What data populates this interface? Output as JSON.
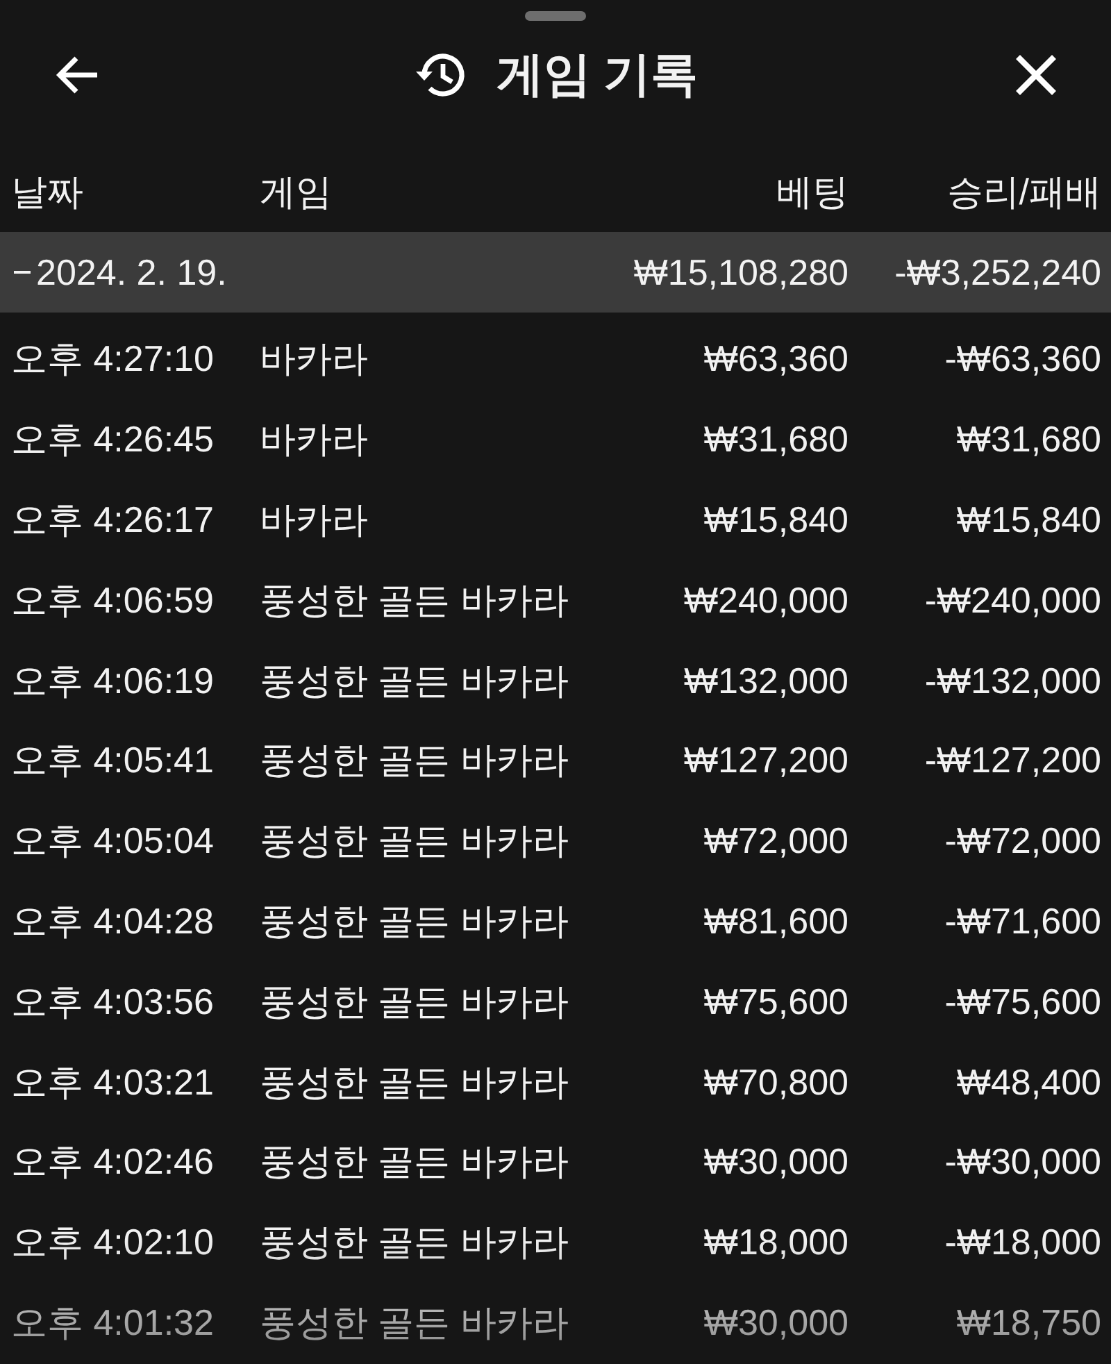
{
  "sheet": {
    "title": "게임 기록"
  },
  "columns": [
    "날짜",
    "게임",
    "베팅",
    "승리/패배"
  ],
  "groups": [
    {
      "date": "2024. 2. 19.",
      "expanded": true,
      "total_bet": "₩15,108,280",
      "total_result": "-₩3,252,240",
      "rows": [
        {
          "time": "오후 4:27:10",
          "game": "바카라",
          "bet": "₩63,360",
          "result": "-₩63,360"
        },
        {
          "time": "오후 4:26:45",
          "game": "바카라",
          "bet": "₩31,680",
          "result": "₩31,680"
        },
        {
          "time": "오후 4:26:17",
          "game": "바카라",
          "bet": "₩15,840",
          "result": "₩15,840"
        },
        {
          "time": "오후 4:06:59",
          "game": "풍성한 골든 바카라",
          "bet": "₩240,000",
          "result": "-₩240,000"
        },
        {
          "time": "오후 4:06:19",
          "game": "풍성한 골든 바카라",
          "bet": "₩132,000",
          "result": "-₩132,000"
        },
        {
          "time": "오후 4:05:41",
          "game": "풍성한 골든 바카라",
          "bet": "₩127,200",
          "result": "-₩127,200"
        },
        {
          "time": "오후 4:05:04",
          "game": "풍성한 골든 바카라",
          "bet": "₩72,000",
          "result": "-₩72,000"
        },
        {
          "time": "오후 4:04:28",
          "game": "풍성한 골든 바카라",
          "bet": "₩81,600",
          "result": "-₩71,600"
        },
        {
          "time": "오후 4:03:56",
          "game": "풍성한 골든 바카라",
          "bet": "₩75,600",
          "result": "-₩75,600"
        },
        {
          "time": "오후 4:03:21",
          "game": "풍성한 골든 바카라",
          "bet": "₩70,800",
          "result": "₩48,400"
        },
        {
          "time": "오후 4:02:46",
          "game": "풍성한 골든 바카라",
          "bet": "₩30,000",
          "result": "-₩30,000"
        },
        {
          "time": "오후 4:02:10",
          "game": "풍성한 골든 바카라",
          "bet": "₩18,000",
          "result": "-₩18,000"
        },
        {
          "time": "오후 4:01:32",
          "game": "풍성한 골든 바카라",
          "bet": "₩30,000",
          "result": "₩18,750"
        }
      ]
    }
  ]
}
